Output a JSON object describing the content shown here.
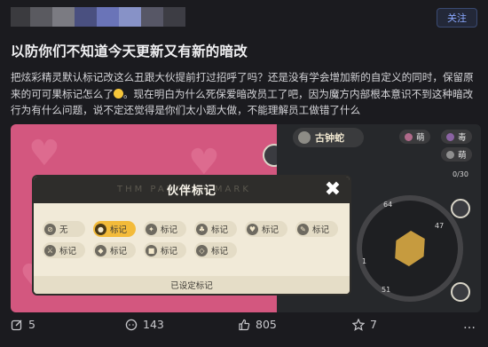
{
  "header": {
    "follow_label": "关注",
    "avatar_blur_colors": [
      "#3b3b3f",
      "#5a5a60",
      "#7b7b82",
      "#4a5080",
      "#6a74b8",
      "#8792c7",
      "#575766",
      "#3d3d44"
    ]
  },
  "post": {
    "title": "以防你们不知道今天更新又有新的暗改",
    "body_1": "把炫彩精灵默认标记改这么丑跟大伙提前打过招呼了吗？还是没有学会增加新的自定义的同时，保留原来的可可果标记怎么了",
    "body_2": "。现在明白为什么死保爱暗改员工了吧，因为魔方内部根本意识不到这种暗改行为有什么问题，说不定还觉得是你们太小题大做，不能理解员工做错了什么"
  },
  "game": {
    "monster_name": "古钟蛇",
    "stat_1": "萌",
    "stat_2": "毒",
    "stat_3": "萌",
    "counter": "0/30",
    "wheel_top": "64",
    "wheel_right": "47",
    "wheel_bottom": "51",
    "wheel_left": "1"
  },
  "dialog": {
    "title": "伙伴标记",
    "ghost_text": "THM PARTNER MARK",
    "close_label": "✖",
    "footer": "已设定标记",
    "tags": [
      {
        "label": "无",
        "icon": "⊘",
        "active": false
      },
      {
        "label": "标记",
        "icon": "●",
        "active": true
      },
      {
        "label": "标记",
        "icon": "✦",
        "active": false
      },
      {
        "label": "标记",
        "icon": "♣",
        "active": false
      },
      {
        "label": "标记",
        "icon": "♥",
        "active": false
      },
      {
        "label": "标记",
        "icon": "✎",
        "active": false
      },
      {
        "label": "标记",
        "icon": "⚔",
        "active": false
      },
      {
        "label": "标记",
        "icon": "◆",
        "active": false
      },
      {
        "label": "标记",
        "icon": "■",
        "active": false
      },
      {
        "label": "标记",
        "icon": "◇",
        "active": false
      }
    ]
  },
  "actions": {
    "edit_count": "5",
    "comment_count": "143",
    "like_count": "805",
    "star_count": "7",
    "more_label": "…"
  }
}
